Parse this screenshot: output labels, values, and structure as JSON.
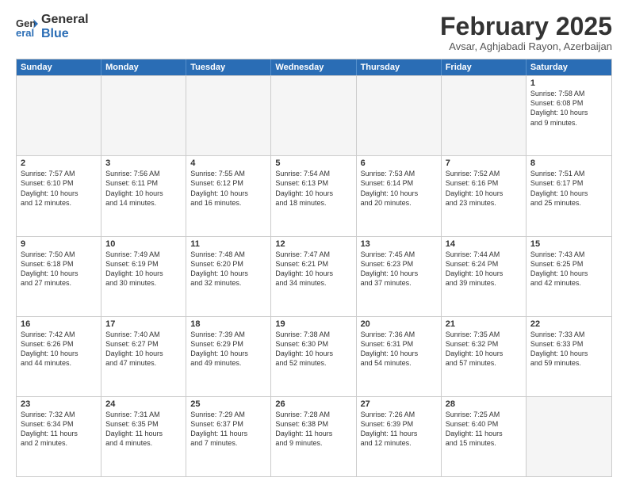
{
  "logo": {
    "general": "General",
    "blue": "Blue"
  },
  "title": "February 2025",
  "subtitle": "Avsar, Aghjabadi Rayon, Azerbaijan",
  "weekdays": [
    "Sunday",
    "Monday",
    "Tuesday",
    "Wednesday",
    "Thursday",
    "Friday",
    "Saturday"
  ],
  "weeks": [
    [
      {
        "day": "",
        "info": ""
      },
      {
        "day": "",
        "info": ""
      },
      {
        "day": "",
        "info": ""
      },
      {
        "day": "",
        "info": ""
      },
      {
        "day": "",
        "info": ""
      },
      {
        "day": "",
        "info": ""
      },
      {
        "day": "1",
        "info": "Sunrise: 7:58 AM\nSunset: 6:08 PM\nDaylight: 10 hours\nand 9 minutes."
      }
    ],
    [
      {
        "day": "2",
        "info": "Sunrise: 7:57 AM\nSunset: 6:10 PM\nDaylight: 10 hours\nand 12 minutes."
      },
      {
        "day": "3",
        "info": "Sunrise: 7:56 AM\nSunset: 6:11 PM\nDaylight: 10 hours\nand 14 minutes."
      },
      {
        "day": "4",
        "info": "Sunrise: 7:55 AM\nSunset: 6:12 PM\nDaylight: 10 hours\nand 16 minutes."
      },
      {
        "day": "5",
        "info": "Sunrise: 7:54 AM\nSunset: 6:13 PM\nDaylight: 10 hours\nand 18 minutes."
      },
      {
        "day": "6",
        "info": "Sunrise: 7:53 AM\nSunset: 6:14 PM\nDaylight: 10 hours\nand 20 minutes."
      },
      {
        "day": "7",
        "info": "Sunrise: 7:52 AM\nSunset: 6:16 PM\nDaylight: 10 hours\nand 23 minutes."
      },
      {
        "day": "8",
        "info": "Sunrise: 7:51 AM\nSunset: 6:17 PM\nDaylight: 10 hours\nand 25 minutes."
      }
    ],
    [
      {
        "day": "9",
        "info": "Sunrise: 7:50 AM\nSunset: 6:18 PM\nDaylight: 10 hours\nand 27 minutes."
      },
      {
        "day": "10",
        "info": "Sunrise: 7:49 AM\nSunset: 6:19 PM\nDaylight: 10 hours\nand 30 minutes."
      },
      {
        "day": "11",
        "info": "Sunrise: 7:48 AM\nSunset: 6:20 PM\nDaylight: 10 hours\nand 32 minutes."
      },
      {
        "day": "12",
        "info": "Sunrise: 7:47 AM\nSunset: 6:21 PM\nDaylight: 10 hours\nand 34 minutes."
      },
      {
        "day": "13",
        "info": "Sunrise: 7:45 AM\nSunset: 6:23 PM\nDaylight: 10 hours\nand 37 minutes."
      },
      {
        "day": "14",
        "info": "Sunrise: 7:44 AM\nSunset: 6:24 PM\nDaylight: 10 hours\nand 39 minutes."
      },
      {
        "day": "15",
        "info": "Sunrise: 7:43 AM\nSunset: 6:25 PM\nDaylight: 10 hours\nand 42 minutes."
      }
    ],
    [
      {
        "day": "16",
        "info": "Sunrise: 7:42 AM\nSunset: 6:26 PM\nDaylight: 10 hours\nand 44 minutes."
      },
      {
        "day": "17",
        "info": "Sunrise: 7:40 AM\nSunset: 6:27 PM\nDaylight: 10 hours\nand 47 minutes."
      },
      {
        "day": "18",
        "info": "Sunrise: 7:39 AM\nSunset: 6:29 PM\nDaylight: 10 hours\nand 49 minutes."
      },
      {
        "day": "19",
        "info": "Sunrise: 7:38 AM\nSunset: 6:30 PM\nDaylight: 10 hours\nand 52 minutes."
      },
      {
        "day": "20",
        "info": "Sunrise: 7:36 AM\nSunset: 6:31 PM\nDaylight: 10 hours\nand 54 minutes."
      },
      {
        "day": "21",
        "info": "Sunrise: 7:35 AM\nSunset: 6:32 PM\nDaylight: 10 hours\nand 57 minutes."
      },
      {
        "day": "22",
        "info": "Sunrise: 7:33 AM\nSunset: 6:33 PM\nDaylight: 10 hours\nand 59 minutes."
      }
    ],
    [
      {
        "day": "23",
        "info": "Sunrise: 7:32 AM\nSunset: 6:34 PM\nDaylight: 11 hours\nand 2 minutes."
      },
      {
        "day": "24",
        "info": "Sunrise: 7:31 AM\nSunset: 6:35 PM\nDaylight: 11 hours\nand 4 minutes."
      },
      {
        "day": "25",
        "info": "Sunrise: 7:29 AM\nSunset: 6:37 PM\nDaylight: 11 hours\nand 7 minutes."
      },
      {
        "day": "26",
        "info": "Sunrise: 7:28 AM\nSunset: 6:38 PM\nDaylight: 11 hours\nand 9 minutes."
      },
      {
        "day": "27",
        "info": "Sunrise: 7:26 AM\nSunset: 6:39 PM\nDaylight: 11 hours\nand 12 minutes."
      },
      {
        "day": "28",
        "info": "Sunrise: 7:25 AM\nSunset: 6:40 PM\nDaylight: 11 hours\nand 15 minutes."
      },
      {
        "day": "",
        "info": ""
      }
    ]
  ]
}
